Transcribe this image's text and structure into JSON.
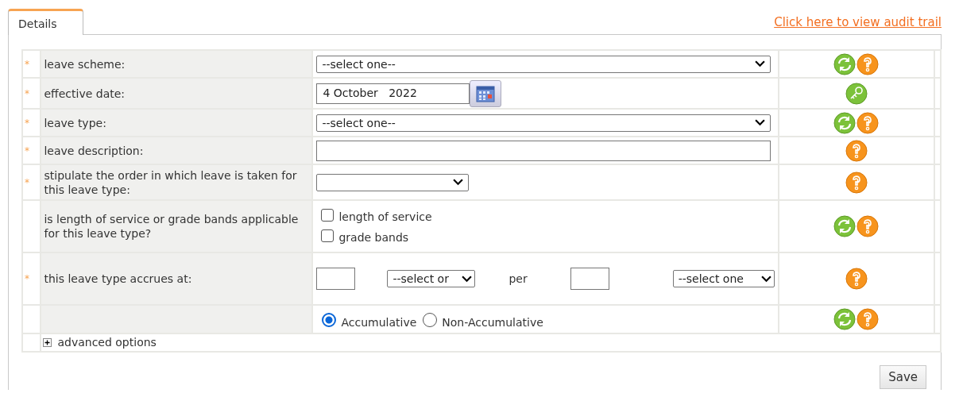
{
  "tabs": [
    {
      "label": "Details",
      "selected": true
    }
  ],
  "audit_link": "Click here to view audit trail",
  "form": {
    "rows": [
      {
        "marker": "*",
        "label": "leave scheme:",
        "kind": "select",
        "value": "--select one--",
        "actions": [
          {
            "kind": "refresh"
          },
          {
            "kind": "help"
          }
        ]
      },
      {
        "marker": "*",
        "label": "effective date:",
        "kind": "date",
        "value": "4 October   2022",
        "actions": [
          {
            "kind": "key"
          }
        ]
      },
      {
        "marker": "*",
        "label": "leave type:",
        "kind": "select",
        "value": "--select one--",
        "actions": [
          {
            "kind": "refresh"
          },
          {
            "kind": "help"
          }
        ]
      },
      {
        "marker": "*",
        "label": "leave description:",
        "kind": "text",
        "actions": [
          {
            "kind": "help"
          }
        ]
      },
      {
        "marker": "*",
        "label": "stipulate the order in which leave is taken for this leave type:",
        "kind": "small_select",
        "actions": [
          {
            "kind": "help"
          }
        ]
      },
      {
        "label": "is length of service or grade bands applicable for this leave type?",
        "kind": "checkboxes",
        "options": [
          {
            "label": "length of service",
            "checked": false
          },
          {
            "label": "grade bands",
            "checked": false
          }
        ],
        "actions": [
          {
            "kind": "refresh"
          },
          {
            "kind": "help"
          }
        ]
      },
      {
        "marker": "*",
        "label": "this leave type accrues at:",
        "kind": "accrual",
        "unit_select": "--select or",
        "per": "per",
        "period_select": "--select one",
        "actions": [
          {
            "kind": "help"
          }
        ]
      },
      {
        "kind": "radios",
        "options": [
          {
            "label": "Accumulative",
            "selected": true
          },
          {
            "label": "Non-Accumulative",
            "selected": false
          }
        ],
        "actions": [
          {
            "kind": "refresh"
          },
          {
            "kind": "help"
          }
        ]
      }
    ],
    "advanced": {
      "label": "advanced options",
      "expanded": false
    }
  },
  "save_button": "Save"
}
